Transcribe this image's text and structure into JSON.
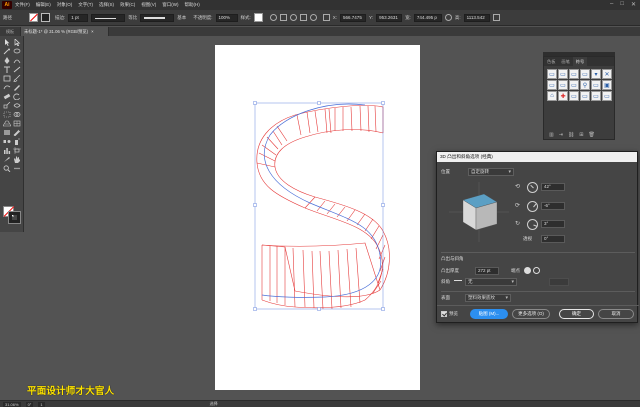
{
  "menubar": {
    "logo": "Ai",
    "items": [
      "文件(F)",
      "编辑(E)",
      "对象(O)",
      "文字(T)",
      "选择(S)",
      "效果(C)",
      "视图(V)",
      "窗口(W)",
      "帮助(H)"
    ],
    "window_controls": [
      "–",
      "□",
      "✕"
    ]
  },
  "controlbar": {
    "selection_label": "路径",
    "stroke_label": "描边:",
    "stroke_value": "1 pt",
    "uniform_label": "等比",
    "basic_label": "基本",
    "opacity_label": "不透明度:",
    "opacity_value": "100%",
    "style_label": "样式:",
    "x_label": "X:",
    "x_value": "566.7475",
    "y_label": "Y:",
    "y_value": "953.2631",
    "w_label": "宽:",
    "w_value": "744.495 p",
    "h_label": "高:",
    "h_value": "1113.542"
  },
  "document": {
    "side_label": "模板",
    "tab_title": "未标题-1* @ 31.06 % (RGB/预览)",
    "tab_close": "×"
  },
  "watermark": "平面设计师才大官人",
  "statusbar": {
    "zoom": "31.06%",
    "rotation": "0°",
    "artboard_nav": "1",
    "tool_name": "选择"
  },
  "symbols_panel": {
    "tabs": [
      "色板",
      "画笔",
      "符号"
    ],
    "active_tab": "符号",
    "bottom_icons": [
      "library-icon",
      "place-symbol-icon",
      "break-link-icon",
      "new-symbol-icon",
      "delete-icon"
    ]
  },
  "extrude_dialog": {
    "title": "3D 凸出和斜角选项 (经典)",
    "position_label": "位置",
    "position_value": "自定旋转",
    "rot_x": "42°",
    "rot_y": "-6°",
    "rot_z": "3°",
    "perspective_label": "透视",
    "perspective_value": "0°",
    "extrude_section": "凸出与斜角",
    "extrude_depth_label": "凸出厚度",
    "extrude_depth_value": "272 pt",
    "cap_label": "端点",
    "bevel_label": "斜角",
    "bevel_value": "无",
    "surface_label": "表面",
    "surface_value": "塑料效果底纹",
    "preview_label": "预览",
    "map_button": "贴图 (M)...",
    "more_options_button": "更多选项 (O)",
    "ok_button": "确定",
    "cancel_button": "取消"
  },
  "colors": {
    "app_bg": "#535353",
    "path_red": "#e53b3b",
    "path_blue": "#4a6fd8",
    "cube_top": "#5b9fc4",
    "primary_button": "#2c8ff0",
    "watermark": "#ffe400"
  }
}
